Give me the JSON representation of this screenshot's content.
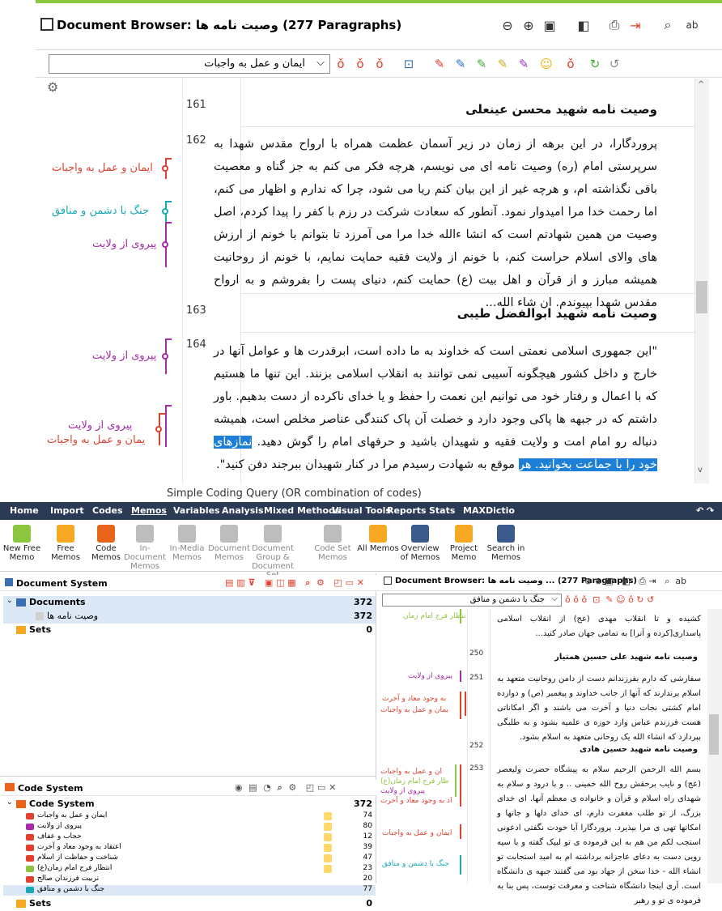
{
  "zoom": {
    "title": "Document Browser: وصیت نامه ها   (277 Paragraphs)",
    "combo_value": "ایمان و عمل به واجبات",
    "paragraphs": [
      {
        "num": "161",
        "heading": "وصیت نامه شهید محسن عینعلی"
      },
      {
        "num": "162",
        "text": "پروردگارا، در این برهه از زمان در زیر آسمان عظمت همراه با ارواح مقدس شهدا به سرپرستی امام (ره) وصیت نامه ای می نویسم، هرچه فکر می کنم به جز گناه و معصیت باقی نگذاشته ام، و هرچه غیر از این بیان کنم ریا می شود، چرا که ندارم و اظهار می کنم، اما رحمت خدا مرا امیدوار نمود. آنطور که سعادت شرکت در رزم با کفر را پیدا کردم، اصل وصیت من همین شهادتم است که انشا ءالله خدا مرا می آمرزد تا بتوانم با خونم از ارزش های والای اسلام حراست کنم، با خونم از ولایت فقیه حمایت نمایم، با خونم از روحانیت همیشه مبارز و از قرآن و اهل بیت (ع) حمایت کنم، دنیای پست را بفروشم و به ارواح مقدس شهدا بپیوندم. ان شاء الله..."
      },
      {
        "num": "163",
        "heading": "وصیت نامه شهید ابوالفضل طیبی"
      },
      {
        "num": "164",
        "text_a": "\"این جمهوری اسلامی نعمتی است که خداوند به ما داده است، ابرقدرت ها و عوامل آنها در خارج و داخل کشور هیچگونه آسیبی نمی توانند به انقلاب اسلامی بزنند. این تنها ما هستیم که با اعمال و رفتار خود می توانیم این نعمت را حفظ و یا خدای ناکرده از دست بدهیم. باور داشتم که در جبهه ها پاکی وجود دارد و خصلت آن پاک کنندگی عناصر مخلص است، همیشه دنباله رو امام امت و ولایت فقیه و شهیدان باشید و حرفهای امام را گوش دهید. ",
        "text_hl": "نمازهای خود را با جماعت بخوانید. هر",
        "text_b": " موقع به شهادت رسیدم مرا در کنار شهیدان ببرجند دفن کنید\"."
      }
    ],
    "margin_codes": [
      {
        "label": "ایمان و عمل به واجبات",
        "color": "#e2402f"
      },
      {
        "label": "جنگ با دشمن و منافق",
        "color": "#19a9b5"
      },
      {
        "label": "پیروی از ولایت",
        "color": "#a62ba8"
      },
      {
        "label": "پیروی از ولایت",
        "color": "#a62ba8"
      },
      {
        "label": "پیروی از ولایت",
        "color": "#a62ba8"
      },
      {
        "label": "یمان و عمل به واجبات",
        "color": "#e2402f"
      }
    ]
  },
  "overlap_caption": "Simple Coding Query (OR combination of codes)",
  "menubar": [
    "Home",
    "Import",
    "Codes",
    "Memos",
    "Variables",
    "Analysis",
    "Mixed Methods",
    "Visual Tools",
    "Reports",
    "Stats",
    "MAXDictio"
  ],
  "ribbon": [
    {
      "label": "New Free Memo",
      "color": "#8cc63f",
      "dim": false
    },
    {
      "label": "Free Memos",
      "color": "#f7a823",
      "dim": false
    },
    {
      "label": "Code Memos",
      "color": "#e8641b",
      "dim": false
    },
    {
      "label": "In-Document Memos",
      "color": "#bdbdbd",
      "dim": true
    },
    {
      "label": "In-Media Memos",
      "color": "#bdbdbd",
      "dim": true
    },
    {
      "label": "Document Memos",
      "color": "#bdbdbd",
      "dim": true
    },
    {
      "label": "Document Group & Document Set Memos",
      "color": "#bdbdbd",
      "dim": true
    },
    {
      "label": "Code Set Memos",
      "color": "#bdbdbd",
      "dim": true
    },
    {
      "label": "All Memos",
      "color": "#f7a823",
      "dim": false
    },
    {
      "label": "Overview of Memos",
      "color": "#3a5a8c",
      "dim": false
    },
    {
      "label": "Project Memo",
      "color": "#f7a823",
      "dim": false
    },
    {
      "label": "Search in Memos",
      "color": "#3a5a8c",
      "dim": false
    }
  ],
  "doc_system": {
    "title": "Document System",
    "rows": [
      {
        "label": "Documents",
        "count": "372"
      },
      {
        "label": "وصیت نامه ها",
        "count": "372"
      },
      {
        "label": "Sets",
        "count": "0"
      }
    ]
  },
  "code_system": {
    "title": "Code System",
    "root": {
      "label": "Code System",
      "count": "372"
    },
    "codes": [
      {
        "label": "ایمان و عمل به واجبات",
        "count": "74",
        "color": "#e2402f"
      },
      {
        "label": "پیروی از ولایت",
        "count": "80",
        "color": "#a62ba8"
      },
      {
        "label": "حجاب و عفاف",
        "count": "12",
        "color": "#e2402f"
      },
      {
        "label": "اعتقاد به وجود معاد و آخرت",
        "count": "39",
        "color": "#e2402f"
      },
      {
        "label": "شناخت و حفاظت از اسلام",
        "count": "47",
        "color": "#e2402f"
      },
      {
        "label": "انتظار فرج امام زمان(ع)",
        "count": "23",
        "color": "#8cc63f"
      },
      {
        "label": "تربیت فرزندان صالح",
        "count": "20",
        "color": "#e2402f"
      },
      {
        "label": "جنگ با دشمن و منافق",
        "count": "77",
        "color": "#19a9b5"
      }
    ],
    "sets": {
      "label": "Sets",
      "count": "0"
    }
  },
  "small_browser": {
    "title": "Document Browser: وصیت نامه ها ...   (277 Paragraphs)",
    "combo_value": "جنگ با دشمن و منافق",
    "top_text": "کشیده و تا انقلاب مهدی (عج) از انقلاب اسلامی پاسداری[کرده و آنرا] به تمامی جهان صادر کنید...",
    "p250": {
      "num": "250",
      "heading": "وصیت نامه شهید علی حسین همتیار"
    },
    "p251": {
      "num": "251",
      "text": "سفارشی که دارم بفرزندانم دست از دامن روحانیت متعهد به اسلام برندارند که آنها از جانب خداوند و پیغمبر (ص) و دوازده امام کشتی نجات دنیا و آخرت می باشند و اگر امکاناتی هست فرزندم عباس وارد حوزه ی علمیه بشود و به طلبگی بپردازد که انشاء الله یک روحانی متعهد به اسلام بشود."
    },
    "p252": {
      "num": "252",
      "heading": "وصیت نامه شهید حسین هادی"
    },
    "p253": {
      "num": "253",
      "text": "بسم الله الرحمن الرحیم سلام به پیشگاه حضرت ولیعصر (عج) و نایب برحقش روح الله خمینی .. و با درود و سلام به شهدای راه اسلام و قرآن و خانواده ی معظم آنها. ای خدای بزرگ، از تو طلب مغفرت دارم، ای خدای دلها و جانها و امکانها تهی ی مرا بپذیرد. پروردگارا آیا خودت نگفتی ادعونی استجب لکم من هم به این فرموده ی تو لبیک گفته و با سیه رویی دست به دعای عاجزانه برداشته ام به امید استجابت تو انشاء الله - خدا سخن از جهاد بود می گفتند جبهه ی دانشگاه است. آری اینجا دانشگاه شناخت و معرفت توست، پس بنا به فرموده ی تو و رهبر"
    },
    "margin": [
      {
        "label": "نتظار فرج امام زمان",
        "color": "#8cc63f"
      },
      {
        "label": "پیروی از ولایت",
        "color": "#a62ba8"
      },
      {
        "label": "به وجود معاد و آخرت",
        "color": "#e2402f"
      },
      {
        "label": "یمان و عمل به واجبات",
        "color": "#e2402f"
      },
      {
        "label": "ان و عمل به واجبات",
        "color": "#e2402f"
      },
      {
        "label": "ظار فرج امام زمان(ع)",
        "color": "#8cc63f"
      },
      {
        "label": "پیروی از ولایت",
        "color": "#a62ba8"
      },
      {
        "label": "اد به وجود معاد و آخرت",
        "color": "#e2402f"
      },
      {
        "label": "ایمان و عمل به واجبات",
        "color": "#e2402f"
      },
      {
        "label": "جنگ با دشمن و منافق",
        "color": "#19a9b5"
      }
    ]
  }
}
